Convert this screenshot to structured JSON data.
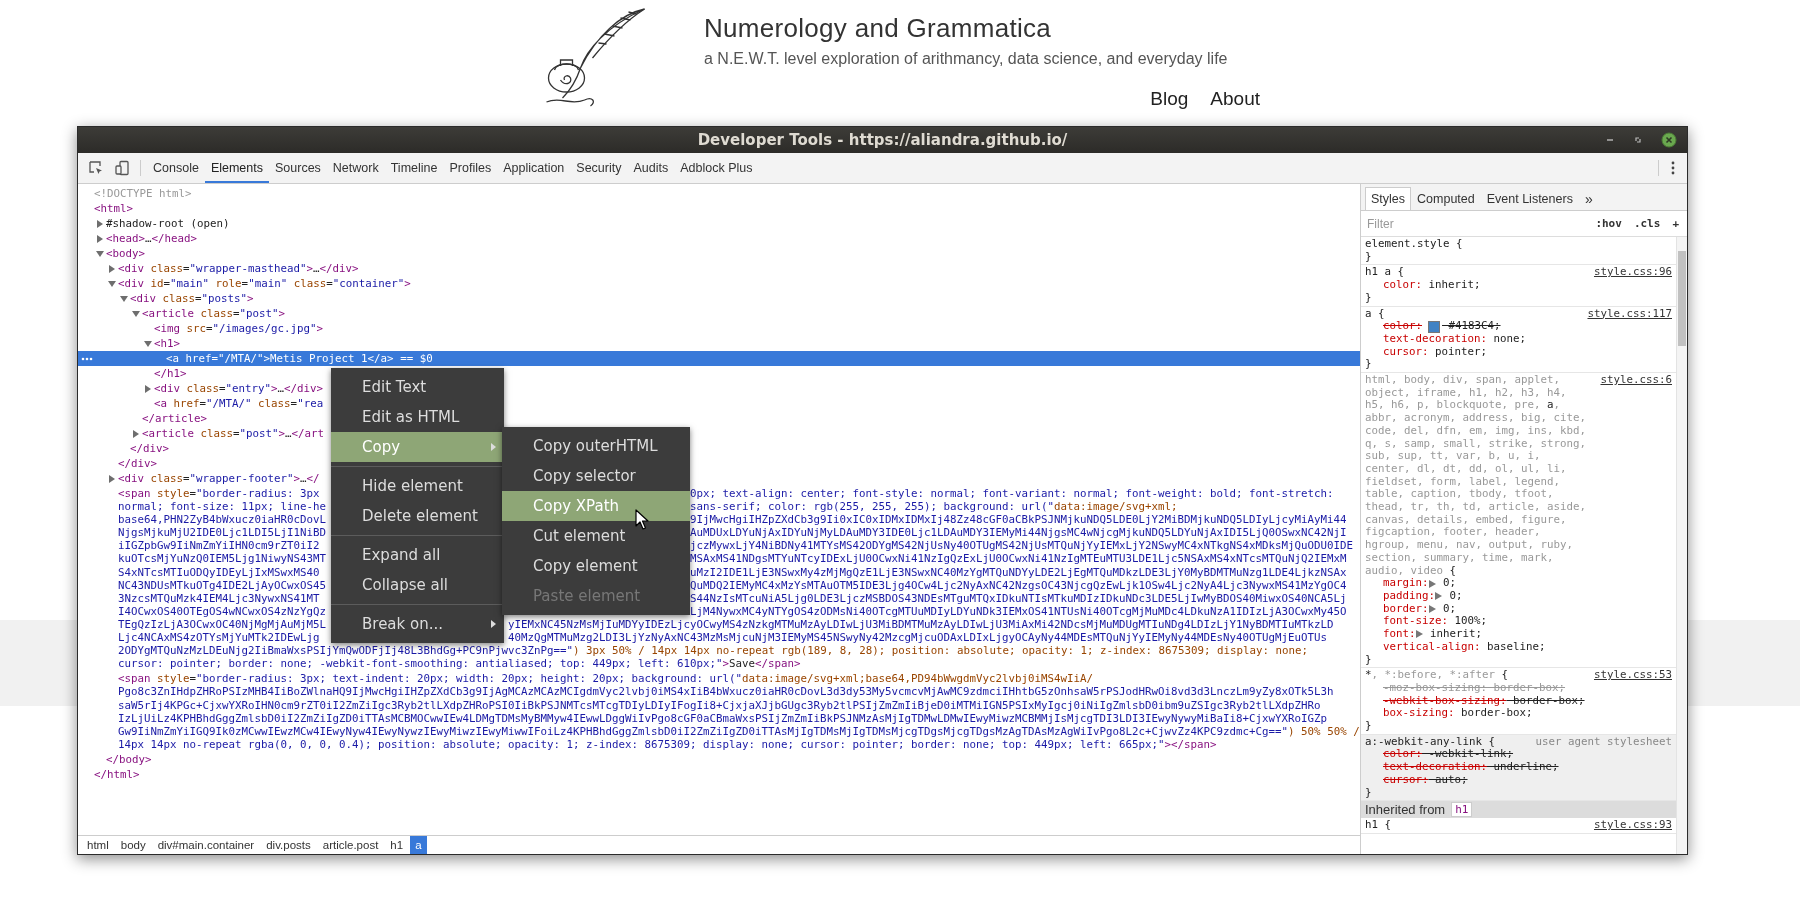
{
  "page": {
    "site_title": "Numerology and Grammatica",
    "tagline": "a N.E.W.T. level exploration of arithmancy, data science, and everyday life",
    "nav": [
      {
        "label": "Blog"
      },
      {
        "label": "About"
      }
    ]
  },
  "devtools": {
    "title": "Developer Tools - https://aliandra.github.io/",
    "tabs": [
      {
        "label": "Console",
        "selected": false
      },
      {
        "label": "Elements",
        "selected": true
      },
      {
        "label": "Sources",
        "selected": false
      },
      {
        "label": "Network",
        "selected": false
      },
      {
        "label": "Timeline",
        "selected": false
      },
      {
        "label": "Profiles",
        "selected": false
      },
      {
        "label": "Application",
        "selected": false
      },
      {
        "label": "Security",
        "selected": false
      },
      {
        "label": "Audits",
        "selected": false
      },
      {
        "label": "Adblock Plus",
        "selected": false
      }
    ],
    "tree": [
      {
        "kind": "doctype",
        "text": "<!DOCTYPE html>",
        "selected": false
      },
      {
        "kind": "bare",
        "text": "<html>",
        "selected": false,
        "close": "</html>",
        "children": [
          {
            "kind": "node",
            "text": "#shadow-root (open)",
            "expanded": false,
            "selected": false
          },
          {
            "kind": "node",
            "text": "<head>…</head>",
            "expanded": false,
            "selected": false
          },
          {
            "kind": "node",
            "text": "<body>",
            "expanded": true,
            "selected": false,
            "close": "</body>",
            "children": [
              {
                "kind": "node",
                "text": "<div class=\"wrapper-masthead\">…</div>",
                "expanded": false,
                "selected": false
              },
              {
                "kind": "node",
                "text": "<div id=\"main\" role=\"main\" class=\"container\">",
                "expanded": true,
                "selected": false,
                "close": "</div>",
                "children": [
                  {
                    "kind": "node",
                    "text": "<div class=\"posts\">",
                    "expanded": true,
                    "selected": false,
                    "close": "</div>",
                    "children": [
                      {
                        "kind": "node",
                        "text": "<article class=\"post\">",
                        "expanded": true,
                        "selected": false,
                        "close": "</article>",
                        "children": [
                          {
                            "kind": "leaf",
                            "text": "<img src=\"/images/gc.jpg\">",
                            "selected": false
                          },
                          {
                            "kind": "node",
                            "text": "<h1>",
                            "expanded": true,
                            "selected": false,
                            "close": "</h1>",
                            "children": [
                              {
                                "kind": "leaf",
                                "text": "<a href=\"/MTA/\">Metis Project 1</a>",
                                "suffix": "== $0",
                                "selected": true
                              }
                            ]
                          },
                          {
                            "kind": "node",
                            "text": "<div class=\"entry\">…</div>",
                            "expanded": false,
                            "selected": false
                          },
                          {
                            "kind": "leaf",
                            "text": "<a href=\"/MTA/\" class=\"rea",
                            "selected": false
                          }
                        ]
                      },
                      {
                        "kind": "node",
                        "text": "<article class=\"post\">…</art",
                        "expanded": false,
                        "selected": false
                      }
                    ]
                  }
                ]
              },
              {
                "kind": "node",
                "text": "<div class=\"wrapper-footer\">…</",
                "expanded": false,
                "selected": false
              },
              {
                "kind": "code",
                "selected": false,
                "lines": [
                  {
                    "kind": "wide",
                    "left": "<span style=\"border-radius: 3px",
                    "right": "0px; text-align: center; font-style: normal; font-variant: normal; font-weight: bold; font-stretch:"
                  },
                  {
                    "kind": "wide",
                    "left": "normal; font-size: 11px; line-he",
                    "right": "sans-serif; color: rgb(255, 255, 255); background: url(\"data:image/svg+xml;"
                  },
                  {
                    "kind": "wide",
                    "left": "base64,PHN2ZyB4bWxucz0iaHR0cDovL",
                    "right": "9IjMwcHgiIHZpZXdCb3g9Ii0xIC0xIDMxIDMxIj48Zz48cGF0aCBkPSJNMjkuNDQ5LDE0LjY2MiBDMjkuNDQ5LDIyLjcyMiAyMi44"
                  },
                  {
                    "kind": "wide",
                    "left": "NjgsMjkuMjU2IDE0Ljc1LDI5LjI1NiBD",
                    "right": "AuMDUxLDYuNjAxIDYuNjMyLDAuMDY3IDE0Ljc1LDAuMDY3IEMyMi44NjgsMC4wNjcgMjkuNDQ5LDYuNjAxIDI5LjQ0OSwxNC42NjI"
                  },
                  {
                    "kind": "wide",
                    "left": "iIGZpbGw9IiNmZmYiIHN0cm9rZT0iI2",
                    "right": "jczMywxLjY4NiBDNy41MTYsMS42ODYgMS42NjUsNy40OTUgMS42NjUsMTQuNjYyIEMxLjY2NSwyMC4xNTkgNS4xMDksMjQuODU0IDE"
                  },
                  {
                    "kind": "wide",
                    "left": "kuOTcsMjYuNzQ0IEM5Ljg1NiwyNS43MT",
                    "right": "MSAxMS41NDgsMTYuNTcyIDExLjU0OCwxNi41NzIgQzExLjU0OCwxNi41NzIgMTEuMTU3LDE1Ljc5NSAxMS4xNTcsMTQuNjQ2IEMxM"
                  },
                  {
                    "kind": "wide",
                    "left": "S4xNTcsMTIuODQyIDEyLjIxMSwxMS40",
                    "right": "uMzI2IDE1LjE3NSwxMy4zMjMgQzE1LjE3NSwxNC40MzYgMTQuNDYyLDE2LjEgMTQuMDkzLDE3LjY0MyBDMTMuNzg1LDE4LjkzNSAx"
                  },
                  {
                    "kind": "wide",
                    "left": "NC43NDUsMTkuOTg4IDE2LjAyOCwxOS45",
                    "right": "QuMDQ2IEMyMC4xMzYsMTAuOTM5IDE3Ljg4OCw4Ljc2NyAxNC42NzgsOC43NjcgQzEwLjk1OSw4Ljc2NyA4Ljc3NywxMS41MzYgOC4"
                  },
                  {
                    "kind": "wide",
                    "left": "3NzcsMTQuMzk4IEM4Ljc3NywxNS41MT",
                    "right": "S44NzIsMTcuNiA5Ljg0LDE3LjczMSBDOS43NDEsMTguMTQxIDkuNTIsMTkuMDIzIDkuNDc3LDE5LjIwMyBDOS40MiwxOS40NCA5Lj"
                  },
                  {
                    "kind": "wide",
                    "left": "I4OCwxOS40OTEgOS4wNCwxOS4zNzYgQz",
                    "right": "LjM4NywxMC4yNTYgOS4zODMsNi40OTcgMTUuMDIyLDYuNDk3IEMxOS41NTUsNi40OTcgMjMuMDc4LDkuNzA1IDIzLjA3OCwxMy45O"
                  },
                  {
                    "kind": "narrow",
                    "left": "TEgQzIzLjA3OCwxOC40NjMgMjAuMjM5L",
                    "right": "yIEMxNC45NzMsMjIuMDYyIDEzLjcyOCwyMS4zNzkgMTMuMzAyLDIwLjU3MiBDMTMuMzAyLDIwLjU3MiAxMi42NDcsMjMuMDUgMTIuNDg4LDIzLjY1NyBDMTIuMTkzLD"
                  },
                  {
                    "kind": "narrow",
                    "left": "Ljc4NCAxMS4zOTYsMjYuMTk2IDEwLjg",
                    "right": "40MzQgMTMuMzg2LDI3LjYzNyAxNC43MzMsMjcuNjM3IEMyMS45NSwyNy42MzcgMjcuODAxLDIxLjgyOCAyNy44MDEsMTQuNjYyIEMyNy44MDEsNy40OTUgMjEuOTUs"
                  },
                  {
                    "kind": "whole",
                    "text": "2ODYgMTQuNzMzLDEuNjg2IiBmaWxsPSIjYmQwODFjIj48L3BhdGg+PC9nPjwvc3ZnPg==\") 3px 50% / 14px 14px no-repeat rgb(189, 8, 28); position: absolute; opacity: 1; z-index: 8675309; display: none;"
                  },
                  {
                    "kind": "whole",
                    "text": "cursor: pointer; border: none; -webkit-font-smoothing: antialiased; top: 449px; left: 610px;\">Save</span>"
                  }
                ]
              },
              {
                "kind": "code",
                "selected": false,
                "lines": [
                  {
                    "kind": "whole",
                    "text": "<span style=\"border-radius: 3px; text-indent: 20px; width: 20px; height: 20px; background: url(\"data:image/svg+xml;base64,PD94bWwgdmVyc2lvbj0iMS4wIiA/"
                  },
                  {
                    "kind": "whole",
                    "text": "Pgo8c3ZnIHdpZHRoPSIzMHB4IiBoZWlnaHQ9IjMwcHgiIHZpZXdCb3g9IjAgMCAzMCAzMCIgdmVyc2lvbj0iMS4xIiB4bWxucz0iaHR0cDovL3d3dy53My5vcmcvMjAwMC9zdmciIHhtbG5zOnhsaW5rPSJodHRwOi8vd3d3LnczLm9yZy8xOTk5L3h"
                  },
                  {
                    "kind": "whole",
                    "text": "saW5rIj4KPGc+CjxwYXRoIHN0cm9rZT0iI2ZmZiIgc3Ryb2tlLXdpZHRoPSI0IiBkPSJNMTcsMTcgTDIyLDIyIFogIi8+CjxjaXJjbGUgc3Ryb2tlPSIjZmZmIiBjeD0iMTMiIGN5PSIxMyIgcj0iNiIgZmlsbD0ibm9uZSIgc3Ryb2tlLXdpZHRo"
                  },
                  {
                    "kind": "whole",
                    "text": "IzLjUiLz4KPHBhdGggZmlsbD0iI2ZmZiIgZD0iTTAsMCBMOCwwIEw4LDMgTDMsMyBMMyw4IEwwLDggWiIvPgo8cGF0aCBmaWxsPSIjZmZmIiBkPSJNMzAsMjIgTDMwLDMwIEwyMiwzMCBMMjIsMjcgTDI3LDI3IEwyNywyMiBaIi8+CjxwYXRoIGZp"
                  },
                  {
                    "kind": "whole",
                    "text": "Gw9IiNmZmYiIGQ9Ik0zMCwwIEwzMCw4IEwyNyw4IEwyNywzIEwyMiwzIEwyMiwwIFoiLz4KPHBhdGggZmlsbD0iI2ZmZiIgZD0iTTAsMjIgTDMsMjIgTDMsMjcgTDgsMjcgTDgsMzAgTDAsMzAgWiIvPgo8L2c+CjwvZz4KPC9zdmc+Cg==\") 50% 50% /"
                  },
                  {
                    "kind": "whole",
                    "text": "14px 14px no-repeat rgba(0, 0, 0, 0.4); position: absolute; opacity: 1; z-index: 8675309; display: none; cursor: pointer; border: none; top: 449px; left: 665px;\"></span>"
                  }
                ]
              }
            ]
          }
        ]
      }
    ],
    "breadcrumb": [
      {
        "label": "html",
        "selected": false
      },
      {
        "label": "body",
        "selected": false
      },
      {
        "label": "div#main.container",
        "selected": false
      },
      {
        "label": "div.posts",
        "selected": false
      },
      {
        "label": "article.post",
        "selected": false
      },
      {
        "label": "h1",
        "selected": false
      },
      {
        "label": "a",
        "selected": true
      }
    ],
    "context_menu": [
      {
        "kind": "item",
        "label": "Edit Text",
        "selected": false,
        "has_submenu": false
      },
      {
        "kind": "item",
        "label": "Edit as HTML",
        "selected": false,
        "has_submenu": false
      },
      {
        "kind": "item",
        "label": "Copy",
        "selected": true,
        "has_submenu": true
      },
      {
        "kind": "separator"
      },
      {
        "kind": "item",
        "label": "Hide element",
        "selected": false,
        "has_submenu": false
      },
      {
        "kind": "item",
        "label": "Delete element",
        "selected": false,
        "has_submenu": false
      },
      {
        "kind": "separator"
      },
      {
        "kind": "item",
        "label": "Expand all",
        "selected": false,
        "has_submenu": false
      },
      {
        "kind": "item",
        "label": "Collapse all",
        "selected": false,
        "has_submenu": false
      },
      {
        "kind": "separator"
      },
      {
        "kind": "item",
        "label": "Break on...",
        "selected": false,
        "has_submenu": true
      }
    ],
    "copy_submenu": [
      {
        "label": "Copy outerHTML",
        "selected": false,
        "disabled": false
      },
      {
        "label": "Copy selector",
        "selected": false,
        "disabled": false
      },
      {
        "label": "Copy XPath",
        "selected": true,
        "disabled": false
      },
      {
        "label": "Cut element",
        "selected": false,
        "disabled": false
      },
      {
        "label": "Copy element",
        "selected": false,
        "disabled": false
      },
      {
        "label": "Paste element",
        "selected": false,
        "disabled": true
      }
    ],
    "styles": {
      "tabs": [
        {
          "label": "Styles",
          "selected": true
        },
        {
          "label": "Computed",
          "selected": false
        },
        {
          "label": "Event Listeners",
          "selected": false
        }
      ],
      "more": "»",
      "filter": {
        "placeholder": "Filter"
      },
      "buttons": [
        ":hov",
        ".cls",
        "+"
      ],
      "sections": [
        {
          "kind": "rule",
          "selector_parts": [
            {
              "text": "element.style {",
              "matched": true
            }
          ],
          "close": "}"
        },
        {
          "kind": "rule",
          "selector_parts": [
            {
              "text": "h1 a {",
              "matched": true
            }
          ],
          "source": "style.css:96",
          "props": [
            {
              "text": "color: inherit;",
              "struck": false,
              "disabled": false,
              "expandable": false
            }
          ],
          "close": "}"
        },
        {
          "kind": "rule",
          "selector_parts": [
            {
              "text": "a {",
              "matched": true
            }
          ],
          "source": "style.css:117",
          "props": [
            {
              "text": "color: #4183C4;",
              "struck": true,
              "disabled": false,
              "expandable": false,
              "color": "#4183c4"
            },
            {
              "text": "text-decoration: none;",
              "struck": false,
              "disabled": false,
              "expandable": false
            },
            {
              "text": "cursor: pointer;",
              "struck": false,
              "disabled": false,
              "expandable": false
            }
          ],
          "close": "}"
        },
        {
          "kind": "rule",
          "selector_parts": [
            {
              "text": "html, body, div, span, applet, object, iframe, h1, h2, h3, h4, h5, h6, p, blockquote, pre, ",
              "matched": false
            },
            {
              "text": "a",
              "matched": true
            },
            {
              "text": ", abbr, acronym, address, big, cite, code, del, dfn, em, img, ins, kbd, q, s, samp, small, strike, strong, sub, sup, tt, var, b, u, i, center, dl, dt, dd, ol, ul, li, fieldset, form, label, legend, table, caption, tbody, tfoot, thead, tr, th, td, article, aside, canvas, details, embed, figure, figcaption, footer, header, hgroup, menu, nav, output, ruby, section, summary, time, mark, audio, video",
              "matched": false
            },
            {
              "text": " {",
              "matched": true
            }
          ],
          "source": "style.css:6",
          "props": [
            {
              "text": "margin: 0;",
              "struck": false,
              "disabled": false,
              "expandable": true
            },
            {
              "text": "padding: 0;",
              "struck": false,
              "disabled": false,
              "expandable": true
            },
            {
              "text": "border: 0;",
              "struck": false,
              "disabled": false,
              "expandable": true
            },
            {
              "text": "font-size: 100%;",
              "struck": false,
              "disabled": false,
              "expandable": false
            },
            {
              "text": "font: inherit;",
              "struck": false,
              "disabled": false,
              "expandable": true
            },
            {
              "text": "vertical-align: baseline;",
              "struck": false,
              "disabled": false,
              "expandable": false
            }
          ],
          "close": "}"
        },
        {
          "kind": "rule",
          "selector_parts": [
            {
              "text": "*",
              "matched": true
            },
            {
              "text": ", *:before, *:after",
              "matched": false
            },
            {
              "text": " {",
              "matched": true
            }
          ],
          "source": "style.css:53",
          "props": [
            {
              "text": "-moz-box-sizing: border-box;",
              "struck": true,
              "disabled": true,
              "expandable": false
            },
            {
              "text": "-webkit-box-sizing: border-box;",
              "struck": true,
              "disabled": false,
              "expandable": false
            },
            {
              "text": "box-sizing: border-box;",
              "struck": false,
              "disabled": false,
              "expandable": false
            }
          ],
          "close": "}"
        },
        {
          "kind": "ua-rule",
          "selector_parts": [
            {
              "text": "a:-webkit-any-link {",
              "matched": true
            }
          ],
          "source": "user agent stylesheet",
          "props": [
            {
              "text": "color: -webkit-link;",
              "struck": true,
              "disabled": false,
              "expandable": false
            },
            {
              "text": "text-decoration: underline;",
              "struck": true,
              "disabled": false,
              "expandable": false
            },
            {
              "text": "cursor: auto;",
              "struck": true,
              "disabled": false,
              "expandable": false
            }
          ],
          "close": "}"
        },
        {
          "kind": "inherited",
          "label": "Inherited from",
          "tag": "h1"
        },
        {
          "kind": "rule",
          "selector_parts": [
            {
              "text": "h1 {",
              "matched": true
            }
          ],
          "source": "style.css:93"
        }
      ]
    }
  }
}
